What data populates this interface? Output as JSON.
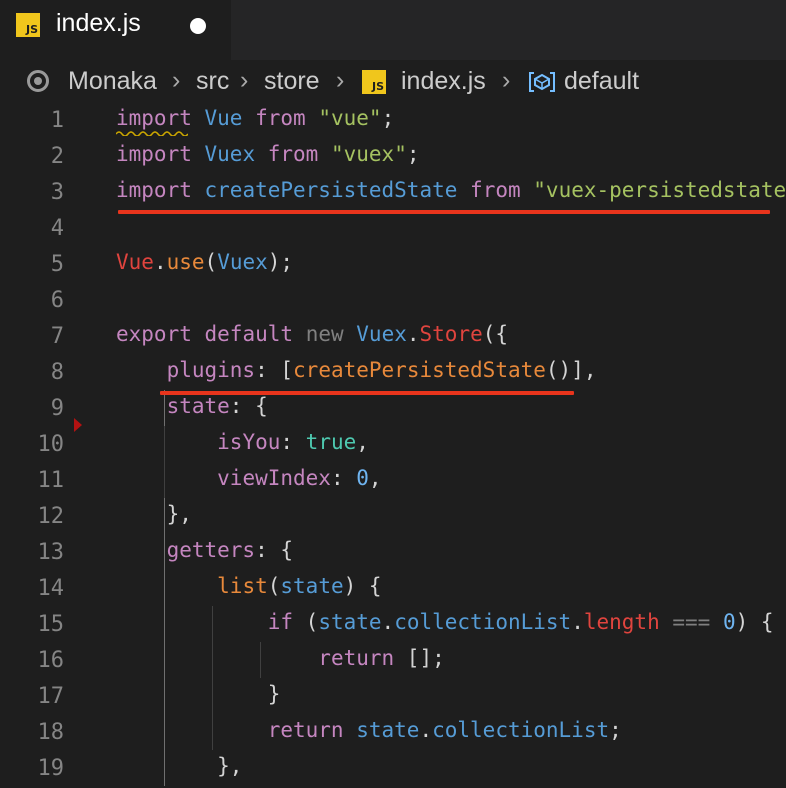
{
  "tab": {
    "title": "index.js",
    "icon": "js-file-icon",
    "dirty": true
  },
  "breadcrumb": {
    "root": "Monaka",
    "folder1": "src",
    "folder2": "store",
    "file": "index.js",
    "symbol": "default"
  },
  "lines": [
    {
      "num": "1",
      "tokens": [
        {
          "t": "import",
          "c": "#c586c0"
        },
        {
          "t": " ",
          "c": "#d4d4d4"
        },
        {
          "t": "Vue",
          "c": "#569cd6"
        },
        {
          "t": " ",
          "c": "#d4d4d4"
        },
        {
          "t": "from",
          "c": "#c586c0"
        },
        {
          "t": " ",
          "c": "#d4d4d4"
        },
        {
          "t": "\"vue\"",
          "c": "#a5c261"
        },
        {
          "t": ";",
          "c": "#d4d4d4"
        }
      ]
    },
    {
      "num": "2",
      "tokens": [
        {
          "t": "import",
          "c": "#c586c0"
        },
        {
          "t": " ",
          "c": "#d4d4d4"
        },
        {
          "t": "Vuex",
          "c": "#569cd6"
        },
        {
          "t": " ",
          "c": "#d4d4d4"
        },
        {
          "t": "from",
          "c": "#c586c0"
        },
        {
          "t": " ",
          "c": "#d4d4d4"
        },
        {
          "t": "\"vuex\"",
          "c": "#a5c261"
        },
        {
          "t": ";",
          "c": "#d4d4d4"
        }
      ]
    },
    {
      "num": "3",
      "tokens": [
        {
          "t": "import",
          "c": "#c586c0"
        },
        {
          "t": " ",
          "c": "#d4d4d4"
        },
        {
          "t": "createPersistedState",
          "c": "#569cd6"
        },
        {
          "t": " ",
          "c": "#d4d4d4"
        },
        {
          "t": "from",
          "c": "#c586c0"
        },
        {
          "t": " ",
          "c": "#d4d4d4"
        },
        {
          "t": "\"vuex-persistedstate\"",
          "c": "#a5c261"
        },
        {
          "t": ";",
          "c": "#d4d4d4"
        }
      ]
    },
    {
      "num": "4",
      "tokens": []
    },
    {
      "num": "5",
      "tokens": [
        {
          "t": "Vue",
          "c": "#e0443e"
        },
        {
          "t": ".",
          "c": "#d4d4d4"
        },
        {
          "t": "use",
          "c": "#e8893b"
        },
        {
          "t": "(",
          "c": "#d4d4d4"
        },
        {
          "t": "Vuex",
          "c": "#569cd6"
        },
        {
          "t": ");",
          "c": "#d4d4d4"
        }
      ]
    },
    {
      "num": "6",
      "tokens": []
    },
    {
      "num": "7",
      "tokens": [
        {
          "t": "export",
          "c": "#c586c0"
        },
        {
          "t": " ",
          "c": "#d4d4d4"
        },
        {
          "t": "default",
          "c": "#c586c0"
        },
        {
          "t": " ",
          "c": "#d4d4d4"
        },
        {
          "t": "new",
          "c": "#808080"
        },
        {
          "t": " ",
          "c": "#d4d4d4"
        },
        {
          "t": "Vuex",
          "c": "#569cd6"
        },
        {
          "t": ".",
          "c": "#d4d4d4"
        },
        {
          "t": "Store",
          "c": "#e0443e"
        },
        {
          "t": "({",
          "c": "#d4d4d4"
        }
      ]
    },
    {
      "num": "8",
      "tokens": [
        {
          "t": "    ",
          "c": "#d4d4d4"
        },
        {
          "t": "plugins",
          "c": "#c586c0"
        },
        {
          "t": ": [",
          "c": "#d4d4d4"
        },
        {
          "t": "createPersistedState",
          "c": "#e8893b"
        },
        {
          "t": "()],",
          "c": "#d4d4d4"
        }
      ]
    },
    {
      "num": "9",
      "tokens": [
        {
          "t": "    ",
          "c": "#d4d4d4"
        },
        {
          "t": "state",
          "c": "#c586c0"
        },
        {
          "t": ": {",
          "c": "#d4d4d4"
        }
      ]
    },
    {
      "num": "10",
      "tokens": [
        {
          "t": "        ",
          "c": "#d4d4d4"
        },
        {
          "t": "isYou",
          "c": "#c586c0"
        },
        {
          "t": ": ",
          "c": "#d4d4d4"
        },
        {
          "t": "true",
          "c": "#4ec9b0"
        },
        {
          "t": ",",
          "c": "#d4d4d4"
        }
      ]
    },
    {
      "num": "11",
      "tokens": [
        {
          "t": "        ",
          "c": "#d4d4d4"
        },
        {
          "t": "viewIndex",
          "c": "#c586c0"
        },
        {
          "t": ": ",
          "c": "#d4d4d4"
        },
        {
          "t": "0",
          "c": "#6fb4f0"
        },
        {
          "t": ",",
          "c": "#d4d4d4"
        }
      ]
    },
    {
      "num": "12",
      "tokens": [
        {
          "t": "    },",
          "c": "#d4d4d4"
        }
      ]
    },
    {
      "num": "13",
      "tokens": [
        {
          "t": "    ",
          "c": "#d4d4d4"
        },
        {
          "t": "getters",
          "c": "#c586c0"
        },
        {
          "t": ": {",
          "c": "#d4d4d4"
        }
      ]
    },
    {
      "num": "14",
      "tokens": [
        {
          "t": "        ",
          "c": "#d4d4d4"
        },
        {
          "t": "list",
          "c": "#e8893b"
        },
        {
          "t": "(",
          "c": "#d4d4d4"
        },
        {
          "t": "state",
          "c": "#569cd6"
        },
        {
          "t": ") {",
          "c": "#d4d4d4"
        }
      ]
    },
    {
      "num": "15",
      "tokens": [
        {
          "t": "            ",
          "c": "#d4d4d4"
        },
        {
          "t": "if",
          "c": "#c586c0"
        },
        {
          "t": " (",
          "c": "#d4d4d4"
        },
        {
          "t": "state",
          "c": "#569cd6"
        },
        {
          "t": ".",
          "c": "#d4d4d4"
        },
        {
          "t": "collectionList",
          "c": "#569cd6"
        },
        {
          "t": ".",
          "c": "#d4d4d4"
        },
        {
          "t": "length",
          "c": "#e0443e"
        },
        {
          "t": " ",
          "c": "#d4d4d4"
        },
        {
          "t": "===",
          "c": "#808080"
        },
        {
          "t": " ",
          "c": "#d4d4d4"
        },
        {
          "t": "0",
          "c": "#6fb4f0"
        },
        {
          "t": ") {",
          "c": "#d4d4d4"
        }
      ]
    },
    {
      "num": "16",
      "tokens": [
        {
          "t": "                ",
          "c": "#d4d4d4"
        },
        {
          "t": "return",
          "c": "#c586c0"
        },
        {
          "t": " [];",
          "c": "#d4d4d4"
        }
      ]
    },
    {
      "num": "17",
      "tokens": [
        {
          "t": "            }",
          "c": "#d4d4d4"
        }
      ]
    },
    {
      "num": "18",
      "tokens": [
        {
          "t": "            ",
          "c": "#d4d4d4"
        },
        {
          "t": "return",
          "c": "#c586c0"
        },
        {
          "t": " ",
          "c": "#d4d4d4"
        },
        {
          "t": "state",
          "c": "#569cd6"
        },
        {
          "t": ".",
          "c": "#d4d4d4"
        },
        {
          "t": "collectionList",
          "c": "#569cd6"
        },
        {
          "t": ";",
          "c": "#d4d4d4"
        }
      ]
    },
    {
      "num": "19",
      "tokens": [
        {
          "t": "        },",
          "c": "#d4d4d4"
        }
      ]
    }
  ]
}
